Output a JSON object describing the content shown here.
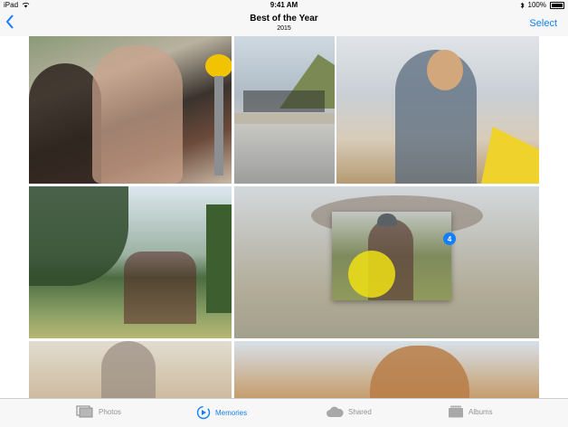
{
  "status_bar": {
    "device": "iPad",
    "time": "9:41 AM",
    "battery": "100%"
  },
  "nav": {
    "title": "Best of the Year",
    "subtitle": "2015",
    "select_label": "Select"
  },
  "drag": {
    "count": "4"
  },
  "tabs": [
    {
      "label": "Photos",
      "icon": "photos-icon",
      "active": false
    },
    {
      "label": "Memories",
      "icon": "memories-icon",
      "active": true
    },
    {
      "label": "Shared",
      "icon": "shared-cloud-icon",
      "active": false
    },
    {
      "label": "Albums",
      "icon": "albums-icon",
      "active": false
    }
  ],
  "colors": {
    "accent": "#147efb",
    "inactive": "#929292",
    "touch": "#f0e114"
  }
}
